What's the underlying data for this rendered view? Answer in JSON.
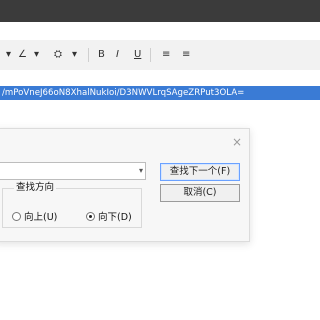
{
  "toolbar": {
    "items": [
      {
        "name": "highlight-dropdown-icon",
        "label": "▾"
      },
      {
        "name": "pen-icon",
        "label": "∠"
      },
      {
        "name": "pen-dropdown-icon",
        "label": "▾"
      },
      {
        "name": "format-painter-icon",
        "label": "⛭"
      },
      {
        "name": "format-dropdown-icon",
        "label": "▾"
      },
      {
        "name": "bold-icon",
        "label": "B"
      },
      {
        "name": "italic-icon",
        "label": "I"
      },
      {
        "name": "underline-icon",
        "label": "U"
      },
      {
        "name": "align-left-icon",
        "label": "≡"
      },
      {
        "name": "align-center-icon",
        "label": "≡"
      }
    ]
  },
  "document": {
    "selected_url_fragment": "/mPoVneJ66oN8XhalNukIoi/D3NWVLrqSAgeZRPut3OLA="
  },
  "find_dialog": {
    "search_value": "",
    "find_next_label": "查找下一个(F)",
    "cancel_label": "取消(C)",
    "direction_label": "查找方向",
    "up_label": "向上(U)",
    "down_label": "向下(D)",
    "close_glyph": "×",
    "dropdown_glyph": "▾"
  }
}
